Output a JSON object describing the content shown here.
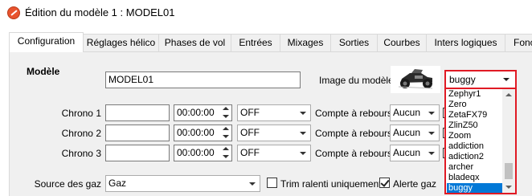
{
  "window": {
    "title": "Édition du modèle 1 : MODEL01"
  },
  "tabs": [
    {
      "label": "Configuration"
    },
    {
      "label": "Réglages hélico"
    },
    {
      "label": "Phases de vol"
    },
    {
      "label": "Entrées"
    },
    {
      "label": "Mixages"
    },
    {
      "label": "Sorties"
    },
    {
      "label": "Courbes"
    },
    {
      "label": "Inters logiques"
    },
    {
      "label": "Fonc"
    }
  ],
  "model": {
    "section_label": "Modèle",
    "name": "MODEL01",
    "image_label": "Image du modèle",
    "image_icon": "buggy-car-image",
    "image_combo_value": "buggy"
  },
  "chronos": [
    {
      "label": "Chrono 1",
      "name": "",
      "time": "00:00:00",
      "mode": "OFF",
      "countdown_label": "Compte à rebours",
      "countdown": "Aucun"
    },
    {
      "label": "Chrono 2",
      "name": "",
      "time": "00:00:00",
      "mode": "OFF",
      "countdown_label": "Compte à rebours",
      "countdown": "Aucun"
    },
    {
      "label": "Chrono 3",
      "name": "",
      "time": "00:00:00",
      "mode": "OFF",
      "countdown_label": "Compte à rebours",
      "countdown": "Aucun"
    }
  ],
  "throttle": {
    "source_label": "Source des gaz",
    "source_value": "Gaz",
    "trim_idle_label": "Trim ralenti uniquement",
    "trim_idle_checked": false,
    "warning_label": "Alerte gaz",
    "warning_checked": true
  },
  "image_dropdown": {
    "options": [
      "Zephyr1",
      "Zero",
      "ZetaFX79",
      "ZlinZ50",
      "Zoom",
      "addiction",
      "adiction2",
      "archer",
      "bladeqx",
      "buggy"
    ],
    "selected": "buggy"
  },
  "colors": {
    "highlight": "#0078d7",
    "focus_border": "#e01a24",
    "panel_bg": "#f0f0f0"
  }
}
